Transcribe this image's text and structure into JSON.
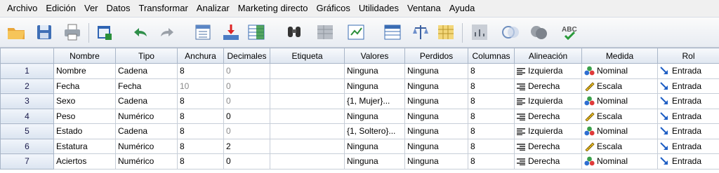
{
  "menu": [
    "Archivo",
    "Edición",
    "Ver",
    "Datos",
    "Transformar",
    "Analizar",
    "Marketing directo",
    "Gráficos",
    "Utilidades",
    "Ventana",
    "Ayuda"
  ],
  "toolbar": {
    "icons": [
      "open-folder-icon",
      "save-icon",
      "print-icon",
      "dialog-recall-icon",
      "undo-icon",
      "redo-icon",
      "goto-case-icon",
      "goto-variable-icon",
      "variables-icon",
      "find-icon",
      "split-file-icon",
      "weight-cases-icon",
      "select-cases-icon",
      "value-labels-icon",
      "use-sets-icon",
      "show-all-variables-icon",
      "spell-check-icon"
    ]
  },
  "grid": {
    "headers": [
      "",
      "Nombre",
      "Tipo",
      "Anchura",
      "Decimales",
      "Etiqueta",
      "Valores",
      "Perdidos",
      "Columnas",
      "Alineación",
      "Medida",
      "Rol"
    ],
    "rows": [
      {
        "num": "1",
        "nombre": "Nombre",
        "tipo": "Cadena",
        "anchura": "8",
        "decimales": "0",
        "etiqueta": "",
        "valores": "Ninguna",
        "perdidos": "Ninguna",
        "columnas": "8",
        "alineacion": "Izquierda",
        "medida": "Nominal",
        "rol": "Entrada"
      },
      {
        "num": "2",
        "nombre": "Fecha",
        "tipo": "Fecha",
        "anchura": "10",
        "decimales": "0",
        "etiqueta": "",
        "valores": "Ninguna",
        "perdidos": "Ninguna",
        "columnas": "8",
        "alineacion": "Derecha",
        "medida": "Escala",
        "rol": "Entrada"
      },
      {
        "num": "3",
        "nombre": "Sexo",
        "tipo": "Cadena",
        "anchura": "8",
        "decimales": "0",
        "etiqueta": "",
        "valores": "{1, Mujer}...",
        "perdidos": "Ninguna",
        "columnas": "8",
        "alineacion": "Izquierda",
        "medida": "Nominal",
        "rol": "Entrada"
      },
      {
        "num": "4",
        "nombre": "Peso",
        "tipo": "Numérico",
        "anchura": "8",
        "decimales": "0",
        "etiqueta": "",
        "valores": "Ninguna",
        "perdidos": "Ninguna",
        "columnas": "8",
        "alineacion": "Derecha",
        "medida": "Escala",
        "rol": "Entrada"
      },
      {
        "num": "5",
        "nombre": "Estado",
        "tipo": "Cadena",
        "anchura": "8",
        "decimales": "0",
        "etiqueta": "",
        "valores": "{1, Soltero}...",
        "perdidos": "Ninguna",
        "columnas": "8",
        "alineacion": "Izquierda",
        "medida": "Nominal",
        "rol": "Entrada"
      },
      {
        "num": "6",
        "nombre": "Estatura",
        "tipo": "Numérico",
        "anchura": "8",
        "decimales": "2",
        "etiqueta": "",
        "valores": "Ninguna",
        "perdidos": "Ninguna",
        "columnas": "8",
        "alineacion": "Derecha",
        "medida": "Escala",
        "rol": "Entrada"
      },
      {
        "num": "7",
        "nombre": "Aciertos",
        "tipo": "Numérico",
        "anchura": "8",
        "decimales": "0",
        "etiqueta": "",
        "valores": "Ninguna",
        "perdidos": "Ninguna",
        "columnas": "8",
        "alineacion": "Derecha",
        "medida": "Nominal",
        "rol": "Entrada"
      }
    ]
  },
  "colors": {
    "rowHeaderText": "#1a1a4a",
    "greyText": "#8a8a8a",
    "roleArrow": "#1f5fc4"
  }
}
